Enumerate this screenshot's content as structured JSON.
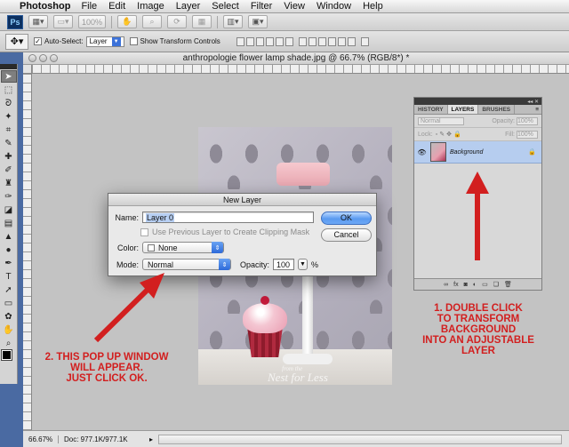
{
  "menubar": {
    "app": "Photoshop",
    "items": [
      "File",
      "Edit",
      "Image",
      "Layer",
      "Select",
      "Filter",
      "View",
      "Window",
      "Help"
    ]
  },
  "appbar": {
    "logo": "Ps",
    "zoom": "100%"
  },
  "options": {
    "auto_select_label": "Auto-Select:",
    "auto_select_checked": true,
    "auto_select_value": "Layer",
    "show_transform_label": "Show Transform Controls"
  },
  "document": {
    "title": "anthropologie flower lamp shade.jpg @ 66.7% (RGB/8*) *",
    "watermark_small": "from the",
    "watermark": "Nest for Less"
  },
  "dialog": {
    "title": "New Layer",
    "name_label": "Name:",
    "name_value": "Layer 0",
    "clipping_label": "Use Previous Layer to Create Clipping Mask",
    "color_label": "Color:",
    "color_value": "None",
    "mode_label": "Mode:",
    "mode_value": "Normal",
    "opacity_label": "Opacity:",
    "opacity_value": "100",
    "opacity_unit": "%",
    "ok_label": "OK",
    "cancel_label": "Cancel"
  },
  "layers_panel": {
    "tabs": [
      "HISTORY",
      "LAYERS",
      "BRUSHES"
    ],
    "active_tab": "LAYERS",
    "blend_mode": "Normal",
    "opacity_label": "Opacity:",
    "opacity_value": "100%",
    "lock_label": "Lock:",
    "fill_label": "Fill:",
    "fill_value": "100%",
    "layer_name": "Background"
  },
  "annotations": {
    "left_lines": [
      "2. THIS POP UP WINDOW",
      "WILL APPEAR.",
      "JUST CLICK OK."
    ],
    "right_lines": [
      "1. DOUBLE CLICK",
      "TO TRANSFORM",
      "BACKGROUND",
      "INTO AN ADJUSTABLE",
      "LAYER"
    ],
    "color": "#d21f1f"
  },
  "statusbar": {
    "zoom": "66.67%",
    "doc": "Doc: 977.1K/977.1K"
  }
}
